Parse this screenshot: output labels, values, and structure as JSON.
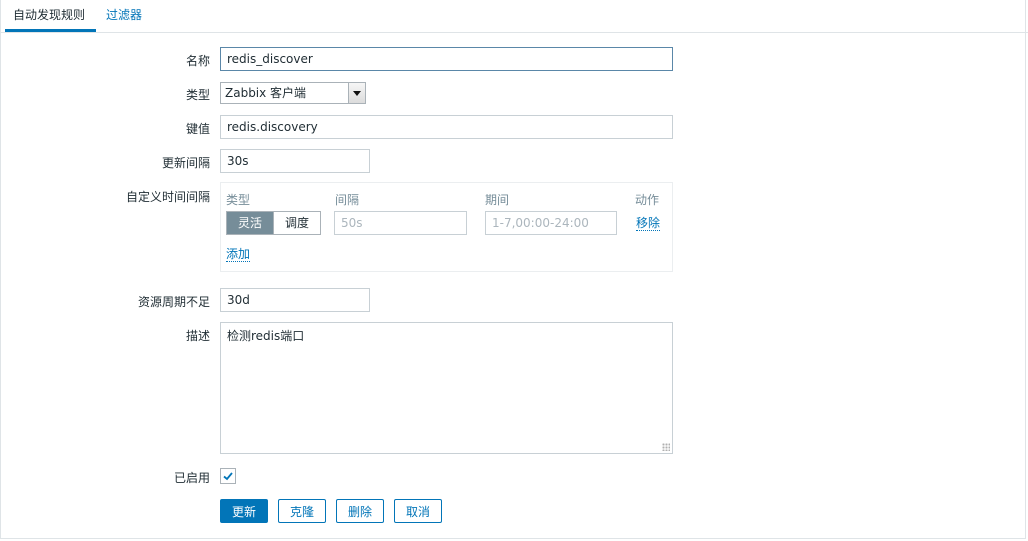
{
  "tabs": [
    {
      "label": "自动发现规则"
    },
    {
      "label": "过滤器"
    }
  ],
  "form": {
    "name": {
      "label": "名称",
      "value": "redis_discover"
    },
    "type": {
      "label": "类型",
      "value": "Zabbix 客户端"
    },
    "key": {
      "label": "键值",
      "value": "redis.discovery"
    },
    "update_interval": {
      "label": "更新间隔",
      "value": "30s"
    },
    "custom_intervals": {
      "label": "自定义时间间隔",
      "headers": {
        "type": "类型",
        "interval": "间隔",
        "period": "期间",
        "action": "动作"
      },
      "row": {
        "type_options": [
          "灵活",
          "调度"
        ],
        "selected_type": "灵活",
        "interval_placeholder": "50s",
        "period_placeholder": "1-7,00:00-24:00",
        "remove_label": "移除"
      },
      "add_label": "添加"
    },
    "lifetime": {
      "label": "资源周期不足",
      "value": "30d"
    },
    "description": {
      "label": "描述",
      "value": "检测redis端口"
    },
    "enabled": {
      "label": "已启用",
      "checked": true
    }
  },
  "buttons": {
    "update": "更新",
    "clone": "克隆",
    "delete": "删除",
    "cancel": "取消"
  },
  "colors": {
    "accent": "#0275b8",
    "segment_active": "#768d99"
  }
}
